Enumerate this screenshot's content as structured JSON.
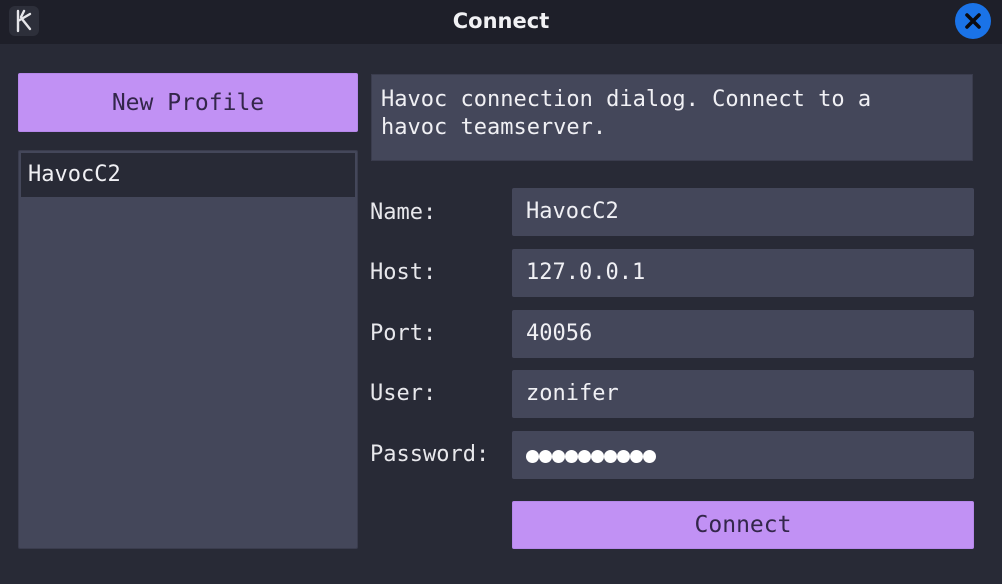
{
  "window": {
    "title": "Connect",
    "app_icon": "havoc-logo-icon",
    "close_icon": "close-icon"
  },
  "sidebar": {
    "new_profile_label": "New Profile",
    "profiles": [
      {
        "name": "HavocC2",
        "selected": true
      }
    ]
  },
  "description": "Havoc connection dialog. Connect to a\nhavoc teamserver.",
  "form": {
    "name": {
      "label": "Name:",
      "value": "HavocC2"
    },
    "host": {
      "label": "Host:",
      "value": "127.0.0.1"
    },
    "port": {
      "label": "Port:",
      "value": "40056"
    },
    "user": {
      "label": "User:",
      "value": "zonifer"
    },
    "password": {
      "label": "Password:",
      "masked_length": 10
    }
  },
  "connect_label": "Connect",
  "colors": {
    "accent": "#c191f4",
    "close_button": "#1a73e8",
    "background": "#282a36",
    "field": "#44475a"
  }
}
